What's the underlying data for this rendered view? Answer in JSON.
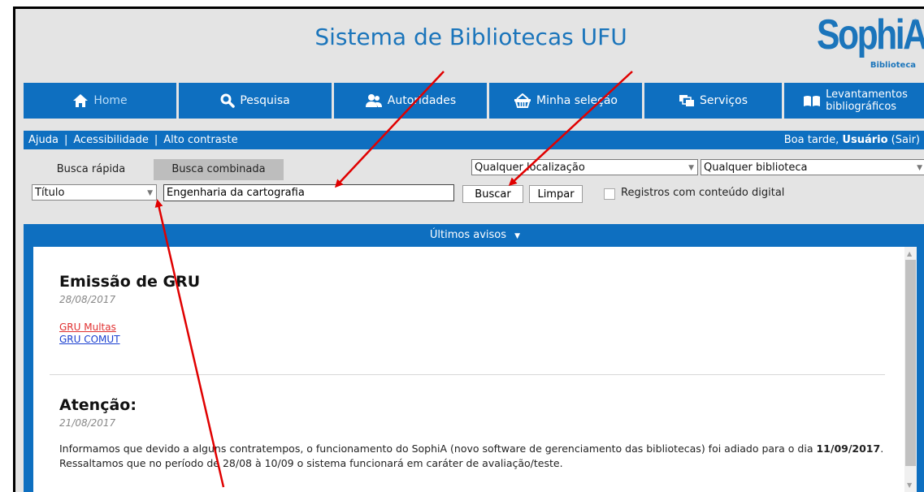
{
  "header": {
    "site_title": "Sistema de Bibliotecas UFU",
    "logo_text": "SophiA",
    "logo_sub": "Biblioteca",
    "logo_reg": "®"
  },
  "nav": [
    {
      "label": "Home",
      "icon": "home-icon"
    },
    {
      "label": "Pesquisa",
      "icon": "search-icon"
    },
    {
      "label": "Autoridades",
      "icon": "users-icon"
    },
    {
      "label": "Minha seleção",
      "icon": "basket-icon"
    },
    {
      "label": "Serviços",
      "icon": "windows-icon"
    },
    {
      "label_line1": "Levantamentos",
      "label_line2": "bibliográficos",
      "icon": "book-icon"
    }
  ],
  "infobar": {
    "ajuda": "Ajuda",
    "sep": "|",
    "acessibilidade": "Acessibilidade",
    "alto_contraste": "Alto contraste",
    "greeting": "Boa tarde, ",
    "user": "Usuário",
    "sair": " (Sair)"
  },
  "search": {
    "tab_quick": "Busca rápida",
    "tab_combined": "Busca combinada",
    "location_select": "Qualquer localização",
    "library_select": "Qualquer biblioteca",
    "field_select": "Título",
    "query_value": "Engenharia da cartografia",
    "buscar": "Buscar",
    "limpar": "Limpar",
    "digital_only_label": "Registros com conteúdo digital"
  },
  "notices": {
    "header": "Últimos avisos",
    "header_caret": "▼",
    "items": [
      {
        "title": "Emissão de GRU",
        "date": "28/08/2017",
        "links": [
          "GRU Multas",
          "GRU COMUT"
        ]
      },
      {
        "title": "Atenção:",
        "date": "21/08/2017",
        "text_part1": "Informamos que devido a alguns contratempos, o funcionamento do SophiA (novo software de gerenciamento das bibliotecas) foi adiado para o dia ",
        "text_bold": "11/09/2017",
        "text_part2": ". Ressaltamos que no período de 28/08 à 10/09 o sistema funcionará em caráter de avaliação/teste."
      }
    ]
  },
  "colors": {
    "brand_blue": "#0e6fc0",
    "annotation_red": "#e00000",
    "link_red": "#e03030",
    "link_blue": "#1a3fd0"
  }
}
